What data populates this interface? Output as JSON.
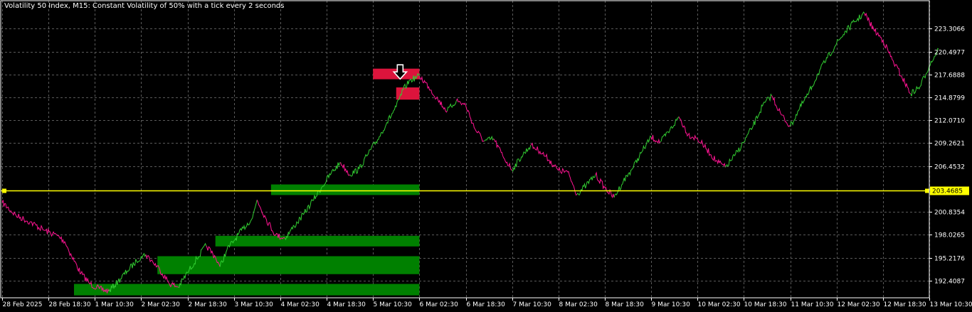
{
  "window": {
    "title": "Volatility 50 Index, M15:  Constant Volatility of 50% with a tick every 2 seconds"
  },
  "colors": {
    "background": "#000000",
    "grid": "#5a5a5a",
    "axis": "#ffffff",
    "up": "#32cd32",
    "down": "#ff1493",
    "current_price_line": "#ffff00",
    "demand_zone": "#008000",
    "supply_zone": "#dc143c",
    "text": "#ffffff"
  },
  "current_price": {
    "value": 203.4685,
    "label": "203.4685"
  },
  "sell_arrow": {
    "icon": "down-arrow-icon",
    "time_index": 9.0,
    "price": 218.0
  },
  "chart_data": {
    "type": "line",
    "title": "Volatility 50 Index, M15:  Constant Volatility of 50% with a tick every 2 seconds",
    "xlabel": "",
    "ylabel": "",
    "ylim": [
      190.3,
      225.6
    ],
    "y_ticks": [
      "223.3066",
      "220.4977",
      "217.6888",
      "214.8799",
      "212.0710",
      "209.2621",
      "206.4532",
      "200.8354",
      "198.0265",
      "195.2176",
      "192.4087"
    ],
    "x_ticks": [
      "28 Feb 2025",
      "28 Feb 18:30",
      "1 Mar 10:30",
      "2 Mar 02:30",
      "2 Mar 18:30",
      "3 Mar 10:30",
      "4 Mar 02:30",
      "4 Mar 18:30",
      "5 Mar 10:30",
      "6 Mar 02:30",
      "6 Mar 18:30",
      "7 Mar 10:30",
      "8 Mar 02:30",
      "8 Mar 18:30",
      "9 Mar 10:30",
      "10 Mar 02:30",
      "10 Mar 18:30",
      "11 Mar 10:30",
      "12 Mar 02:30",
      "12 Mar 18:30",
      "13 Mar 10:30"
    ],
    "grid": true,
    "series": [
      {
        "x": [
          0.0,
          0.3,
          0.6,
          0.9,
          1.2,
          1.35,
          1.5,
          1.7,
          1.9,
          2.1,
          2.3,
          2.5,
          2.7,
          2.9,
          3.0,
          3.1,
          3.25,
          3.4,
          3.6,
          3.8,
          4.0,
          4.2,
          4.4,
          4.6,
          4.7,
          4.85,
          5.0,
          5.2,
          5.4,
          5.5,
          5.7,
          5.9,
          6.1,
          6.3,
          6.5,
          6.7,
          6.9,
          7.1,
          7.3,
          7.5,
          7.7,
          7.9,
          8.1,
          8.3,
          8.5,
          8.65,
          8.8,
          9.0,
          9.2,
          9.4,
          9.6,
          9.8,
          10.0,
          10.2,
          10.4,
          10.6,
          10.8,
          11.0,
          11.2,
          11.4,
          11.6,
          11.8,
          12.0,
          12.2,
          12.4,
          12.6,
          12.8,
          13.0,
          13.2,
          13.4,
          13.6,
          13.8,
          14.0,
          14.2,
          14.4,
          14.6,
          14.8,
          15.0,
          15.2,
          15.4,
          15.6,
          15.8,
          16.0,
          16.2,
          16.4,
          16.6,
          16.8,
          17.0,
          17.2,
          17.4,
          17.6,
          17.8,
          18.0,
          18.2,
          18.4,
          18.6,
          18.8,
          19.0,
          19.2,
          19.4,
          19.6,
          19.8,
          20.0,
          20.2
        ],
        "y": [
          202.0,
          200.4,
          199.6,
          198.6,
          197.9,
          197.2,
          195.4,
          193.3,
          192.0,
          191.4,
          191.1,
          192.3,
          193.6,
          194.8,
          195.4,
          195.6,
          194.7,
          193.8,
          192.1,
          191.6,
          193.4,
          195.1,
          196.7,
          195.3,
          194.1,
          196.2,
          197.3,
          198.8,
          200.1,
          202.3,
          199.9,
          198.0,
          197.6,
          199.1,
          200.5,
          202.2,
          203.9,
          205.6,
          206.9,
          205.4,
          206.1,
          208.0,
          209.7,
          211.8,
          213.7,
          215.8,
          217.0,
          217.5,
          216.2,
          214.6,
          213.2,
          214.5,
          213.9,
          211.0,
          209.5,
          209.8,
          207.7,
          206.0,
          207.6,
          209.0,
          208.3,
          207.2,
          205.9,
          205.7,
          203.0,
          204.1,
          205.4,
          203.8,
          202.6,
          204.6,
          206.2,
          208.2,
          210.0,
          209.4,
          210.8,
          212.5,
          210.3,
          209.8,
          208.5,
          207.1,
          206.3,
          207.7,
          209.4,
          211.4,
          213.8,
          215.1,
          212.8,
          211.3,
          213.5,
          215.4,
          217.8,
          219.7,
          221.5,
          223.0,
          224.2,
          225.2,
          223.2,
          221.9,
          219.5,
          217.5,
          215.3,
          216.2,
          218.8,
          220.8
        ]
      }
    ]
  }
}
